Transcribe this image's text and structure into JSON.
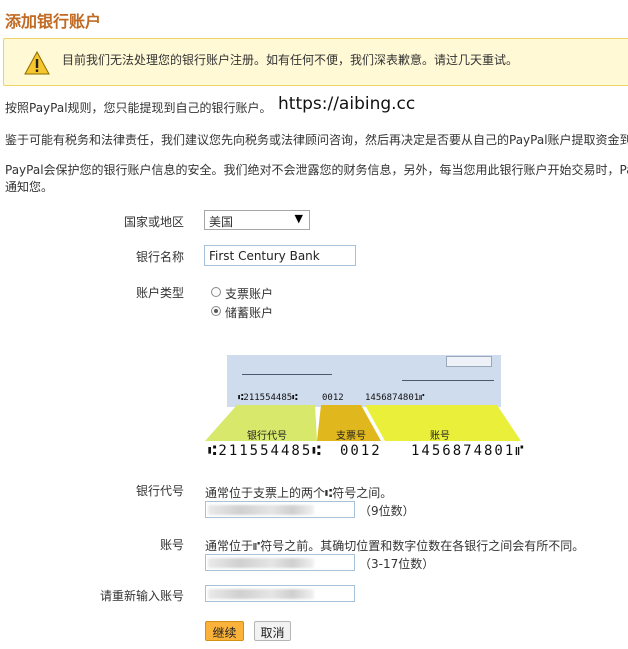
{
  "page": {
    "title": "添加银行账户",
    "warning": "目前我们无法处理您的银行账户注册。如有任何不便，我们深表歉意。请过几天重试。",
    "watermark": "https://aibing.cc",
    "para1": "按照PayPal规则，您只能提现到自己的银行账户。",
    "para2": "鉴于可能有税务和法律责任，我们建议您先向税务或法律顾问咨询，然后再决定是否要从自己的PayPal账户提取资金到",
    "para3a": "PayPal会保护您的银行账户信息的安全。我们绝对不会泄露您的财务信息，另外，每当您用此银行账户开始交易时，Pa",
    "para3b": "通知您。"
  },
  "form": {
    "country_label": "国家或地区",
    "country_value": "美国",
    "bank_name_label": "银行名称",
    "bank_name_value": "First Century Bank",
    "account_type_label": "账户类型",
    "account_types": [
      {
        "label": "支票账户",
        "selected": false
      },
      {
        "label": "储蓄账户",
        "selected": true
      }
    ],
    "routing_label": "银行代号",
    "routing_help": "通常位于支票上的两个⑆符号之间。",
    "routing_hint": "（9位数）",
    "account_label": "账号",
    "account_help": "通常位于⑈符号之前。其确切位置和数字位数在各银行之间会有所不同。",
    "account_hint": "（3-17位数）",
    "reenter_label": "请重新输入账号",
    "continue_button": "继续",
    "cancel_button": "取消"
  },
  "check_image": {
    "micr_small_routing": "⑆211554485⑆",
    "micr_small_check": "0012",
    "micr_small_account": "1456874801⑈",
    "seg_routing": "银行代号",
    "seg_check": "支票号",
    "seg_account": "账号",
    "micr_big_routing": "⑆211554485⑆",
    "micr_big_check": "0012",
    "micr_big_account": "1456874801⑈"
  },
  "colors": {
    "title": "#c06a23",
    "warning_bg": "#fff9d6",
    "segment_routing": "#d7e86a",
    "segment_check": "#e0b71c",
    "segment_account": "#eaf03a",
    "primary_button": "#fbb23b"
  }
}
